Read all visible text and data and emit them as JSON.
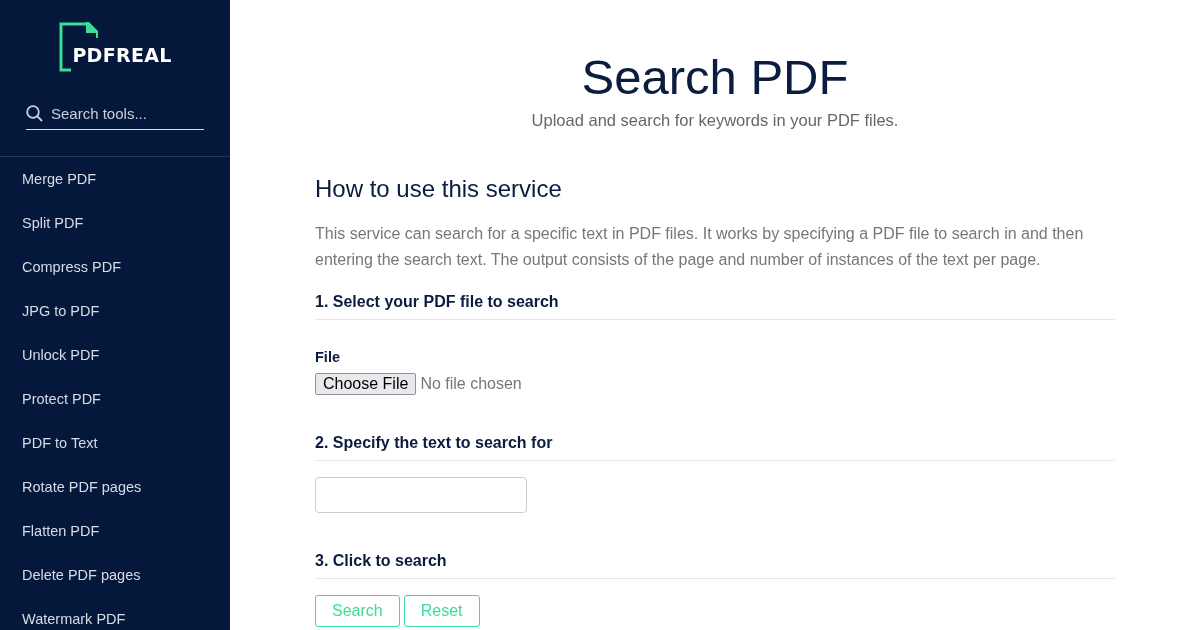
{
  "sidebar": {
    "logo": "PDFREAL",
    "search": {
      "placeholder": "Search tools..."
    },
    "items": [
      {
        "label": "Merge PDF"
      },
      {
        "label": "Split PDF"
      },
      {
        "label": "Compress PDF"
      },
      {
        "label": "JPG to PDF"
      },
      {
        "label": "Unlock PDF"
      },
      {
        "label": "Protect PDF"
      },
      {
        "label": "PDF to Text"
      },
      {
        "label": "Rotate PDF pages"
      },
      {
        "label": "Flatten PDF"
      },
      {
        "label": "Delete PDF pages"
      },
      {
        "label": "Watermark PDF"
      }
    ]
  },
  "header": {
    "title": "Search PDF",
    "subtitle": "Upload and search for keywords in your PDF files."
  },
  "howto": {
    "heading": "How to use this service",
    "text": "This service can search for a specific text in PDF files. It works by specifying a PDF file to search in and then entering the search text. The output consists of the page and number of instances of the text per page."
  },
  "steps": [
    {
      "heading": "1. Select your PDF file to search",
      "kind": "file",
      "label": "File",
      "button": "Choose File",
      "status": "No file chosen"
    },
    {
      "heading": "2. Specify the text to search for",
      "kind": "text"
    },
    {
      "heading": "3. Click to search",
      "kind": "buttons",
      "buttons": [
        "Search",
        "Reset"
      ]
    }
  ]
}
